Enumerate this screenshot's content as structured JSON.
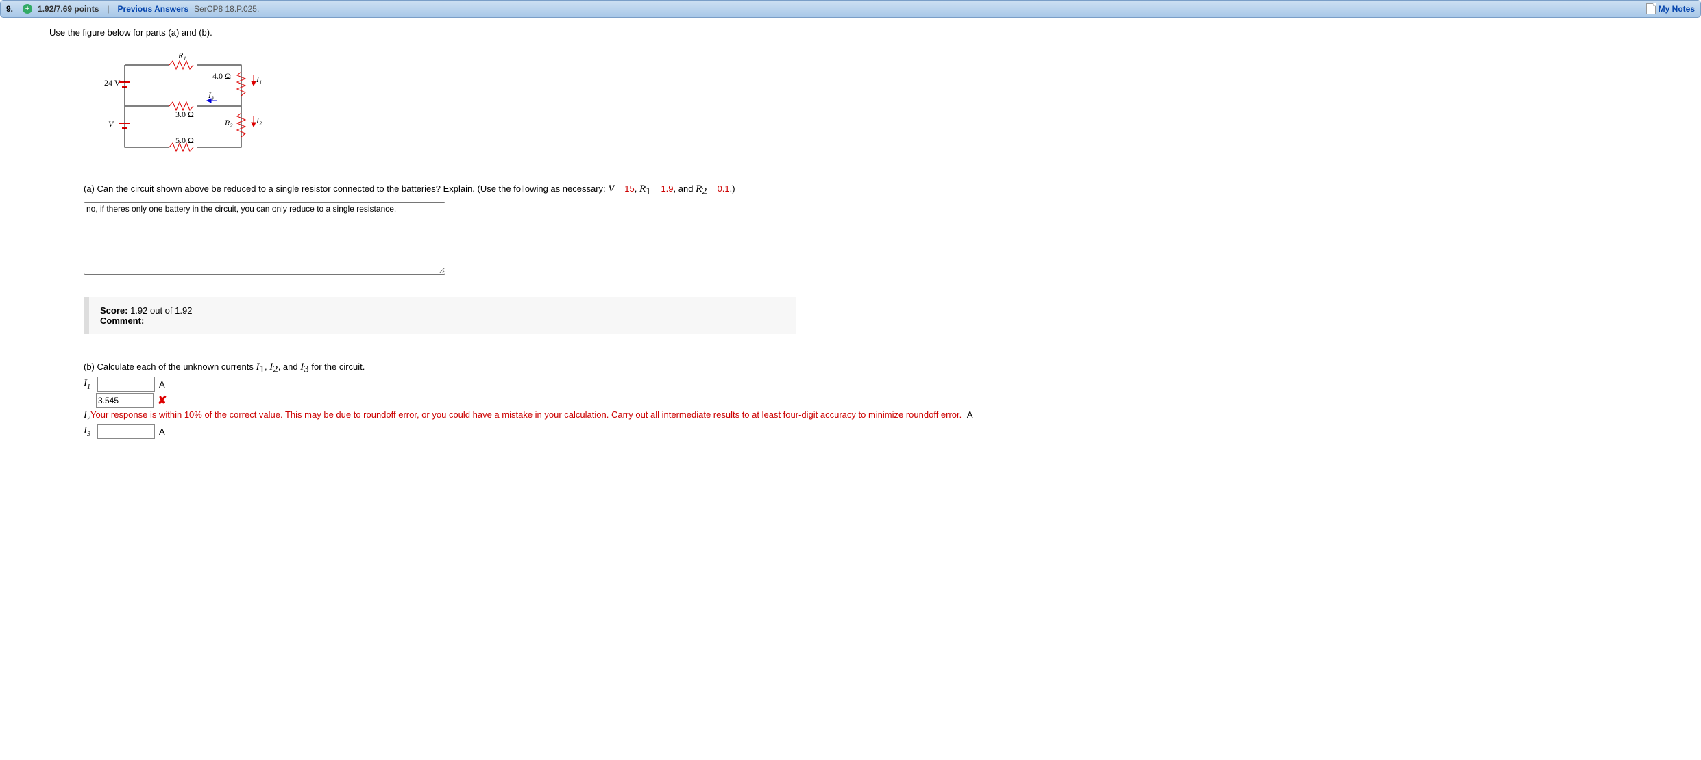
{
  "header": {
    "number": "9.",
    "points": "1.92/7.69 points",
    "prev_answers": "Previous Answers",
    "ref": "SerCP8 18.P.025.",
    "mynotes": "My Notes"
  },
  "prompt": "Use the figure below for parts (a) and (b).",
  "circuit": {
    "R1": "R₁",
    "v24": "24 V",
    "r40": "4.0 Ω",
    "I1": "I₁",
    "I3": "I₃",
    "r30": "3.0 Ω",
    "V": "V",
    "R2": "R₂",
    "I2": "I₂",
    "r50": "5.0 Ω"
  },
  "part_a": {
    "q_prefix": "(a) Can the circuit shown above be reduced to a single resistor connected to the batteries? Explain. (Use the following as necessary: ",
    "V": "V",
    "eq1": " = ",
    "vval": "15",
    "comma1": ", ",
    "R1": "R",
    "R1sub": "1",
    "eq2": " = ",
    "r1val": "1.9",
    "comma2": ", and ",
    "R2": "R",
    "R2sub": "2",
    "eq3": " = ",
    "r2val": "0.1",
    "end": ".)",
    "answer": "no, if theres only one battery in the circuit, you can only reduce to a single resistance."
  },
  "feedback": {
    "score_label": "Score:",
    "score_val": " 1.92 out of 1.92",
    "comment_label": "Comment:",
    "comment_val": ""
  },
  "part_b": {
    "q": "(b) Calculate each of the unknown currents ",
    "I1": "I",
    "I1s": "1",
    "sep1": ", ",
    "I2": "I",
    "I2s": "2",
    "sep2": ", and ",
    "I3": "I",
    "I3s": "3",
    "end": " for the circuit.",
    "rows": {
      "i1": {
        "label_html": "I<sub>1</sub>",
        "value": "",
        "unit": "A"
      },
      "i2": {
        "label_html": "I<sub>2</sub>",
        "value": "3.545",
        "unit": "A",
        "fb": "Your response is within 10% of the correct value. This may be due to roundoff error, or you could have a mistake in your calculation. Carry out all intermediate results to at least four-digit accuracy to minimize roundoff error."
      },
      "i3": {
        "label_html": "I<sub>3</sub>",
        "value": "",
        "unit": "A"
      }
    }
  }
}
